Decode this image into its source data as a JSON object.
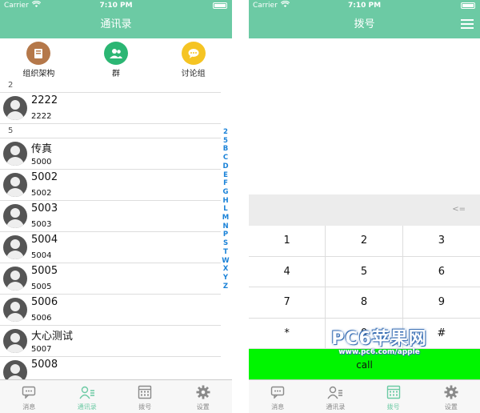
{
  "left": {
    "status": {
      "carrier": "Carrier",
      "time": "7:10 PM"
    },
    "title": "通讯录",
    "groups": [
      {
        "label": "组织架构",
        "icon": "book-icon",
        "color": "#b5784a"
      },
      {
        "label": "群",
        "icon": "group-icon",
        "color": "#2bb673"
      },
      {
        "label": "讨论组",
        "icon": "chat-bubble-icon",
        "color": "#f5c423"
      }
    ],
    "sections": [
      {
        "header": "2",
        "contacts": [
          {
            "name": "2222",
            "number": "2222"
          }
        ]
      },
      {
        "header": "5",
        "contacts": [
          {
            "name": "传真",
            "number": "5000"
          },
          {
            "name": "5002",
            "number": "5002"
          },
          {
            "name": "5003",
            "number": "5003"
          },
          {
            "name": "5004",
            "number": "5004"
          },
          {
            "name": "5005",
            "number": "5005"
          },
          {
            "name": "5006",
            "number": "5006"
          },
          {
            "name": "大心测试",
            "number": "5007"
          },
          {
            "name": "5008",
            "number": ""
          }
        ]
      }
    ],
    "index": [
      "2",
      "5",
      "B",
      "C",
      "D",
      "E",
      "F",
      "G",
      "H",
      "L",
      "M",
      "N",
      "P",
      "S",
      "T",
      "W",
      "X",
      "Y",
      "Z"
    ]
  },
  "right": {
    "status": {
      "carrier": "Carrier",
      "time": "7:10 PM"
    },
    "title": "拨号",
    "backspace": "<=",
    "keys": [
      "1",
      "2",
      "3",
      "4",
      "5",
      "6",
      "7",
      "8",
      "9",
      "*",
      "0",
      "#"
    ],
    "call": "call"
  },
  "tabs": [
    {
      "label": "消息",
      "icon": "message-icon"
    },
    {
      "label": "通讯录",
      "icon": "contacts-icon"
    },
    {
      "label": "拨号",
      "icon": "dialpad-icon"
    },
    {
      "label": "设置",
      "icon": "gear-icon"
    }
  ],
  "left_active_tab": 1,
  "right_active_tab": 2,
  "accent_color": "#6ccaa4",
  "call_color": "#00f500",
  "link_color": "#1a82d8",
  "watermark": {
    "brand": "PC6苹果网",
    "url": "www.pc6.com/apple"
  }
}
